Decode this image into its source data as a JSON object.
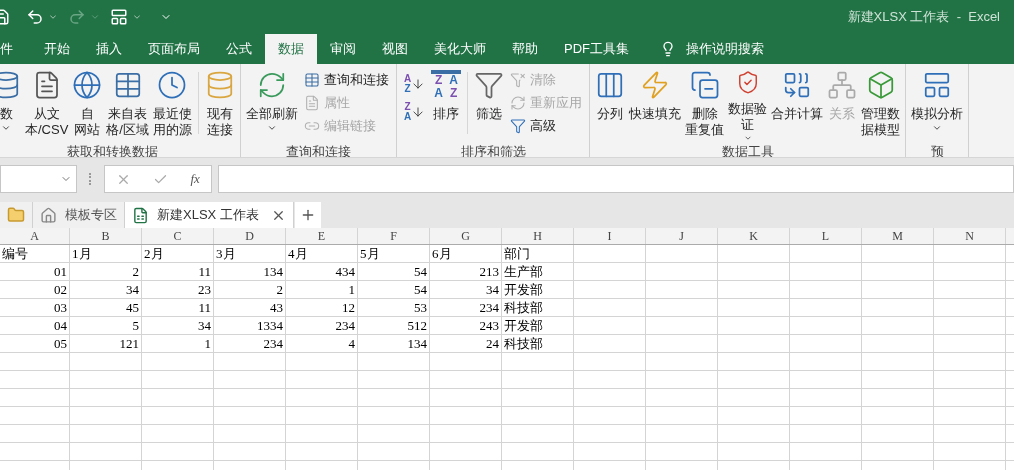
{
  "title_bar": {
    "title": "新建XLSX 工作表  -  Excel"
  },
  "tabs": [
    {
      "label": "件",
      "selected": false
    },
    {
      "label": "开始",
      "selected": false
    },
    {
      "label": "插入",
      "selected": false
    },
    {
      "label": "页面布局",
      "selected": false
    },
    {
      "label": "公式",
      "selected": false
    },
    {
      "label": "数据",
      "selected": true
    },
    {
      "label": "审阅",
      "selected": false
    },
    {
      "label": "视图",
      "selected": false
    },
    {
      "label": "美化大师",
      "selected": false
    },
    {
      "label": "帮助",
      "selected": false
    },
    {
      "label": "PDF工具集",
      "selected": false
    }
  ],
  "tell_me": {
    "label": "操作说明搜索"
  },
  "ribbon_groups": [
    {
      "label": "获取和转换数据",
      "items": [
        {
          "kind": "large",
          "lines": [
            "数"
          ],
          "dropdown": true,
          "disabled": false
        },
        {
          "kind": "large",
          "lines": [
            "从文",
            "本/CSV"
          ],
          "dropdown": false,
          "disabled": false
        },
        {
          "kind": "large",
          "lines": [
            "自",
            "网站"
          ],
          "dropdown": false,
          "disabled": false
        },
        {
          "kind": "large",
          "lines": [
            "来自表",
            "格/区域"
          ],
          "dropdown": false,
          "disabled": false
        },
        {
          "kind": "large",
          "lines": [
            "最近使",
            "用的源"
          ],
          "dropdown": false,
          "disabled": false
        },
        {
          "kind": "separator"
        },
        {
          "kind": "large",
          "lines": [
            "现有",
            "连接"
          ],
          "dropdown": false,
          "disabled": false
        }
      ]
    },
    {
      "label": "查询和连接",
      "items": [
        {
          "kind": "large",
          "lines": [
            "全部刷新"
          ],
          "dropdown": true,
          "disabled": false
        },
        {
          "kind": "stack",
          "buttons": [
            {
              "label": "查询和连接",
              "disabled": false
            },
            {
              "label": "属性",
              "disabled": true
            },
            {
              "label": "编辑链接",
              "disabled": true
            }
          ]
        }
      ]
    },
    {
      "label": "排序和筛选",
      "items": [
        {
          "kind": "sort_pair",
          "buttons": [
            {
              "letters": [
                "A",
                "Z"
              ]
            },
            {
              "letters": [
                "Z",
                "A"
              ]
            }
          ]
        },
        {
          "kind": "large",
          "lines": [
            "排序"
          ],
          "letters": [
            "Z",
            "A",
            "A",
            "Z"
          ],
          "dropdown": false,
          "disabled": false
        },
        {
          "kind": "separator"
        },
        {
          "kind": "large",
          "lines": [
            "筛选"
          ],
          "dropdown": false,
          "disabled": false
        },
        {
          "kind": "stack",
          "buttons": [
            {
              "label": "清除",
              "disabled": true
            },
            {
              "label": "重新应用",
              "disabled": true
            },
            {
              "label": "高级",
              "disabled": false
            }
          ]
        }
      ]
    },
    {
      "label": "数据工具",
      "items": [
        {
          "kind": "large",
          "lines": [
            "分列"
          ],
          "dropdown": false,
          "disabled": false
        },
        {
          "kind": "large",
          "lines": [
            "快速填充"
          ],
          "dropdown": false,
          "disabled": false
        },
        {
          "kind": "large",
          "lines": [
            "删除",
            "重复值"
          ],
          "dropdown": false,
          "disabled": false
        },
        {
          "kind": "large",
          "lines": [
            "数据验",
            "证"
          ],
          "dropdown": true,
          "disabled": false
        },
        {
          "kind": "large",
          "lines": [
            "合并计算"
          ],
          "dropdown": false,
          "disabled": false
        },
        {
          "kind": "large",
          "lines": [
            "关系"
          ],
          "dropdown": false,
          "disabled": true
        },
        {
          "kind": "large",
          "lines": [
            "管理数",
            "据模型"
          ],
          "dropdown": false,
          "disabled": false
        }
      ]
    },
    {
      "label": "预",
      "items": [
        {
          "kind": "large",
          "lines": [
            "模拟分析"
          ],
          "dropdown": true,
          "disabled": false
        }
      ]
    }
  ],
  "formula_bar": {
    "fx": "fx"
  },
  "sheet_tabs": [
    {
      "kind": "folder",
      "selected": false
    },
    {
      "kind": "home",
      "label": "模板专区",
      "selected": false
    },
    {
      "kind": "workbook",
      "label": "新建XLSX 工作表",
      "selected": true
    }
  ],
  "grid": {
    "columns": [
      "A",
      "B",
      "C",
      "D",
      "E",
      "F",
      "G",
      "H",
      "I",
      "J",
      "K",
      "L",
      "M",
      "N"
    ],
    "rows": [
      {
        "kind": "header",
        "cells": [
          "编号",
          "1月",
          "2月",
          "3月",
          "4月",
          "5月",
          "6月",
          "部门"
        ]
      },
      {
        "kind": "data",
        "cells": [
          "01",
          "2",
          "11",
          "134",
          "434",
          "54",
          "213",
          "生产部"
        ]
      },
      {
        "kind": "data",
        "cells": [
          "02",
          "34",
          "23",
          "2",
          "1",
          "54",
          "34",
          "开发部"
        ]
      },
      {
        "kind": "data",
        "cells": [
          "03",
          "45",
          "11",
          "43",
          "12",
          "53",
          "234",
          "科技部"
        ]
      },
      {
        "kind": "data",
        "cells": [
          "04",
          "5",
          "34",
          "1334",
          "234",
          "512",
          "243",
          "开发部"
        ]
      },
      {
        "kind": "data",
        "cells": [
          "05",
          "121",
          "1",
          "234",
          "4",
          "134",
          "24",
          "科技部"
        ]
      }
    ]
  }
}
